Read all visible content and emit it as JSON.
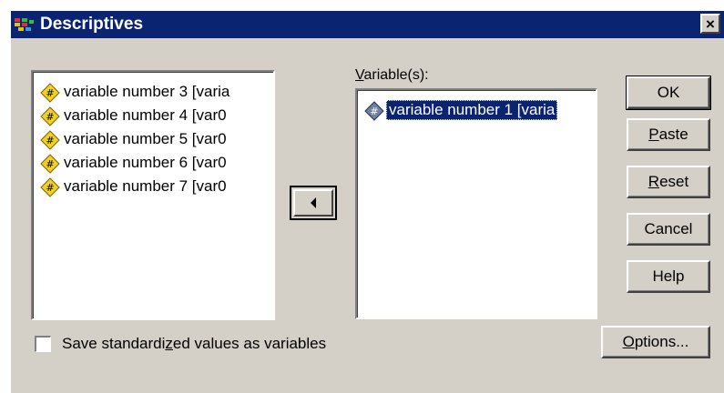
{
  "window": {
    "title": "Descriptives",
    "close_glyph": "×"
  },
  "source_list": {
    "items": [
      {
        "label": "variable number 3 [varia"
      },
      {
        "label": "variable number 4 [var0"
      },
      {
        "label": "variable number 5 [var0"
      },
      {
        "label": "variable number 6 [var0"
      },
      {
        "label": "variable number 7 [var0"
      }
    ],
    "icon": "numeric-variable-icon"
  },
  "target_list": {
    "label_prefix": "V",
    "label_rest": "ariable(s):",
    "items": [
      {
        "label": "variable number 1 [varia",
        "selected": true
      }
    ]
  },
  "move_button": {
    "icon": "left-arrow-icon"
  },
  "buttons": {
    "ok": {
      "label": "OK"
    },
    "paste": {
      "mnemonic": "P",
      "rest": "aste"
    },
    "reset": {
      "mnemonic": "R",
      "rest": "eset"
    },
    "cancel": {
      "label": "Cancel"
    },
    "help": {
      "label": "Help"
    },
    "options": {
      "mnemonic": "O",
      "rest": "ptions..."
    }
  },
  "save_standardized": {
    "label_before": "Save standardi",
    "mnemonic": "z",
    "label_after": "ed values as variables",
    "checked": false
  },
  "colors": {
    "titlebar": "#0a2472",
    "face": "#d4d0c8",
    "selection": "#0a2472"
  }
}
